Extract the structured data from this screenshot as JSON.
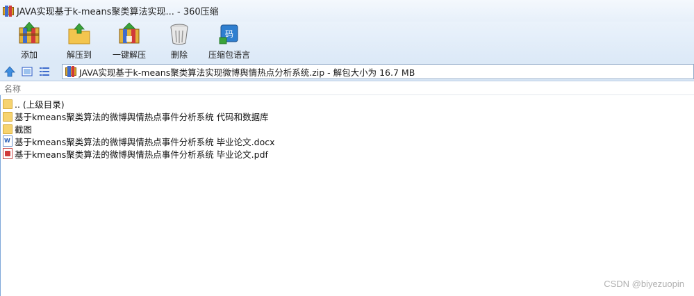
{
  "window": {
    "title": "JAVA实现基于k-means聚类算法实现... - 360压缩"
  },
  "toolbar": {
    "items": [
      {
        "label": "添加",
        "icon": "add-archive-icon"
      },
      {
        "label": "解压到",
        "icon": "extract-to-icon"
      },
      {
        "label": "一键解压",
        "icon": "one-click-extract-icon"
      },
      {
        "label": "删除",
        "icon": "delete-trash-icon"
      },
      {
        "label": "压缩包语言",
        "icon": "archive-language-icon"
      }
    ]
  },
  "address": {
    "path": "JAVA实现基于k-means聚类算法实现微博舆情热点分析系统.zip - 解包大小为 16.7 MB"
  },
  "list": {
    "column_name": "名称",
    "rows": [
      {
        "name": ".. (上级目录)",
        "type": "folder"
      },
      {
        "name": "基于kmeans聚类算法的微博舆情热点事件分析系统 代码和数据库",
        "type": "folder"
      },
      {
        "name": "截图",
        "type": "folder"
      },
      {
        "name": "基于kmeans聚类算法的微博舆情热点事件分析系统 毕业论文.docx",
        "type": "docx"
      },
      {
        "name": "基于kmeans聚类算法的微博舆情热点事件分析系统 毕业论文.pdf",
        "type": "pdf"
      }
    ]
  },
  "watermark": "CSDN @biyezuopin",
  "colors": {
    "titlebar": "#e7f0fa",
    "toolbar": "#dce9f7",
    "folder": "#f6d36f",
    "accent_blue": "#3f6ccc"
  }
}
